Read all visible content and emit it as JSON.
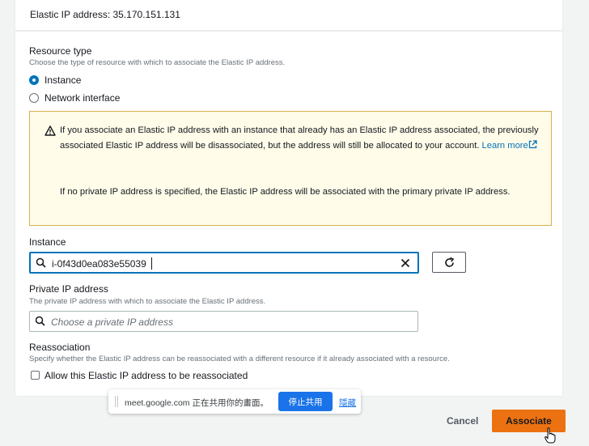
{
  "header": {
    "elastic_ip_text": "Elastic IP address: 35.170.151.131"
  },
  "resource_type": {
    "label": "Resource type",
    "description": "Choose the type of resource with which to associate the Elastic IP address.",
    "options": [
      {
        "label": "Instance",
        "checked": true
      },
      {
        "label": "Network interface",
        "checked": false
      }
    ]
  },
  "alert": {
    "line1_prefix": "If you associate an Elastic IP address with an instance that already has an Elastic IP address associated, the previously associated Elastic IP address will be disassociated, but the address will still be allocated to your account.",
    "learn_more": "Learn more",
    "line2": "If no private IP address is specified, the Elastic IP address will be associated with the primary private IP address."
  },
  "instance": {
    "label": "Instance",
    "value": "i-0f43d0ea083e55039"
  },
  "private_ip": {
    "label": "Private IP address",
    "description": "The private IP address with which to associate the Elastic IP address.",
    "placeholder": "Choose a private IP address"
  },
  "reassociation": {
    "label": "Reassociation",
    "description": "Specify whether the Elastic IP address can be reassociated with a different resource if it already associated with a resource.",
    "checkbox_label": "Allow this Elastic IP address to be reassociated"
  },
  "share_bar": {
    "message": "meet.google.com 正在共用你的畫面。",
    "stop_label": "停止共用",
    "hide_label": "隱藏"
  },
  "footer": {
    "cancel_label": "Cancel",
    "associate_label": "Associate"
  },
  "colors": {
    "primary": "#ec7211",
    "link": "#0073bb",
    "alert_bg": "#fffce9",
    "alert_border": "#d5b24d"
  }
}
